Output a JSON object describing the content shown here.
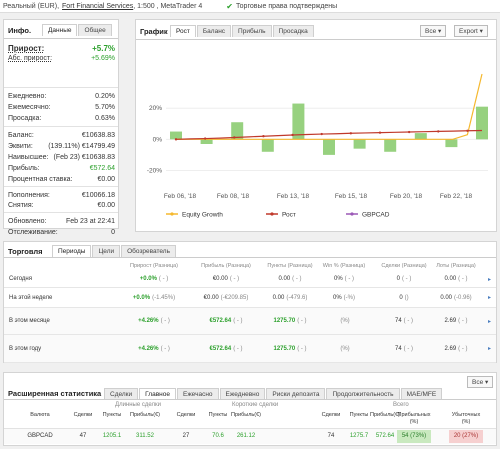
{
  "topbar": {
    "account": "Реальный (EUR),",
    "broker": "Fort Financial Services",
    "rest": ", 1:500 , MetaTrader 4",
    "check": "✔",
    "rights": "Торговые права подтверждены"
  },
  "info": {
    "title": "Инфо.",
    "tabs": [
      "Данные",
      "Общее"
    ],
    "growth_label": "Прирост:",
    "growth_value": "+5.7%",
    "abs_label": "Абс. прирост:",
    "abs_value": "+5.69%",
    "rows1": [
      {
        "label": "Ежедневно:",
        "value": "0.20%"
      },
      {
        "label": "Ежемесячно:",
        "value": "5.70%"
      },
      {
        "label": "Просадка:",
        "value": "0.63%"
      }
    ],
    "rows2": [
      {
        "label": "Баланс:",
        "value": "€10638.83",
        "cls": ""
      },
      {
        "label": "Эквити:",
        "value": "(139.11%) €14799.49",
        "cls": ""
      },
      {
        "label": "Наивысшее:",
        "value": "(Feb 23) €10638.83",
        "cls": ""
      },
      {
        "label": "Прибыль:",
        "value": "€572.64",
        "cls": "green"
      },
      {
        "label": "Процентная ставка:",
        "value": "€0.00",
        "cls": ""
      }
    ],
    "rows3": [
      {
        "label": "Пополнения:",
        "value": "€10066.18"
      },
      {
        "label": "Снятия:",
        "value": "€0.00"
      }
    ],
    "rows4": [
      {
        "label": "Обновлено:",
        "value": "Feb 23 at 22:41"
      },
      {
        "label": "Отслеживание:",
        "value": "0"
      }
    ]
  },
  "graph": {
    "title": "График",
    "tabs": [
      "Рост",
      "Баланс",
      "Прибыль",
      "Просадка"
    ],
    "dropdown": "Все",
    "export": "Export"
  },
  "chart_data": {
    "type": "bar",
    "y_ticks": [
      "20%",
      "0%",
      "-20%"
    ],
    "ylim": [
      -30,
      60
    ],
    "x_ticks": [
      "Feb 06, '18",
      "Feb 08, '18",
      "Feb 13, '18",
      "Feb 15, '18",
      "Feb 20, '18",
      "Feb 22, '18"
    ],
    "bars": [
      5,
      -3,
      11,
      -8,
      23,
      -10,
      -6,
      -8,
      4,
      -5,
      21
    ],
    "series": [
      {
        "name": "Equity Growth",
        "color": "#f5b82e",
        "values": [
          0,
          0,
          0,
          0,
          0,
          0,
          0,
          0,
          0,
          0,
          0,
          0,
          0,
          0,
          0,
          0,
          0,
          0,
          0,
          0,
          3,
          42
        ]
      },
      {
        "name": "Рост",
        "color": "#c0392b",
        "values": [
          0,
          0.3,
          0.5,
          0.8,
          1.2,
          1.6,
          2.0,
          2.4,
          2.8,
          3.1,
          3.4,
          3.6,
          3.9,
          4.1,
          4.3,
          4.5,
          4.7,
          4.9,
          5.1,
          5.3,
          5.5,
          5.7
        ]
      },
      {
        "name": "GBPCAD",
        "color": "#9b59b6",
        "values": []
      }
    ]
  },
  "trading": {
    "title": "Торговля",
    "tabs": [
      "Периоды",
      "Цели",
      "Обозреватель"
    ],
    "headers": [
      "Прирост (Разница)",
      "Прибыль (Разница)",
      "Пункты (Разница)",
      "Win % (Разница)",
      "Сделки (Разница)",
      "Лоты (Разница)"
    ],
    "rows": [
      {
        "label": "Сегодня",
        "growth": "+0.0%",
        "growth_diff": "( - )",
        "profit": "€0.00",
        "profit_diff": "( - )",
        "pips": "0.00",
        "pips_diff": "( - )",
        "win": "0%",
        "win_diff": "( - )",
        "trades": "0",
        "trades_diff": "( - )",
        "lots": "0.00",
        "lots_diff": "( - )"
      },
      {
        "label": "На этой неделе",
        "growth": "+0.0%",
        "growth_diff": "(-1.45%)",
        "profit": "€0.00",
        "profit_diff": "(-€209.85)",
        "pips": "0.00",
        "pips_diff": "(-479.6)",
        "win": "0%",
        "win_diff": "(-%)",
        "trades": "0",
        "trades_diff": "()",
        "lots": "0.00",
        "lots_diff": "(-0.96)"
      },
      {
        "label": "В этом месяце",
        "growth": "+4.26%",
        "growth_diff": "( - )",
        "profit": "€572.64",
        "profit_diff": "( - )",
        "pips": "1275.70",
        "pips_diff": "( - )",
        "win": "",
        "win_diff": "(%)",
        "trades": "74",
        "trades_diff": "( - )",
        "lots": "2.69",
        "lots_diff": "( - )"
      },
      {
        "label": "В этом году",
        "growth": "+4.26%",
        "growth_diff": "( - )",
        "profit": "€572.64",
        "profit_diff": "( - )",
        "pips": "1275.70",
        "pips_diff": "( - )",
        "win": "",
        "win_diff": "(%)",
        "trades": "74",
        "trades_diff": "( - )",
        "lots": "2.69",
        "lots_diff": "( - )"
      }
    ]
  },
  "ext": {
    "title": "Расширенная статистика",
    "tabs": [
      "Сделки",
      "Главное",
      "Ежечасно",
      "Ежедневно",
      "Риски депозита",
      "Продолжительность",
      "MAE/MFE"
    ],
    "dropdown": "Все",
    "group_long": "Длинные сделки",
    "group_short": "Короткие сделки",
    "group_all": "Всего",
    "headers": [
      "Валюта",
      "Сделки",
      "Пункты",
      "Прибыль(€)",
      "Сделки",
      "Пункты",
      "Прибыль(€)",
      "Сделки",
      "Пункты",
      "Прибыль(€)",
      "Прибыльных (%)",
      "Убыточных (%)"
    ],
    "row": [
      "GBPCAD",
      "47",
      "1205.1",
      "311.52",
      "27",
      "70.6",
      "261.12",
      "74",
      "1275.7",
      "572.64",
      "54 (73%)",
      "20 (27%)"
    ]
  }
}
